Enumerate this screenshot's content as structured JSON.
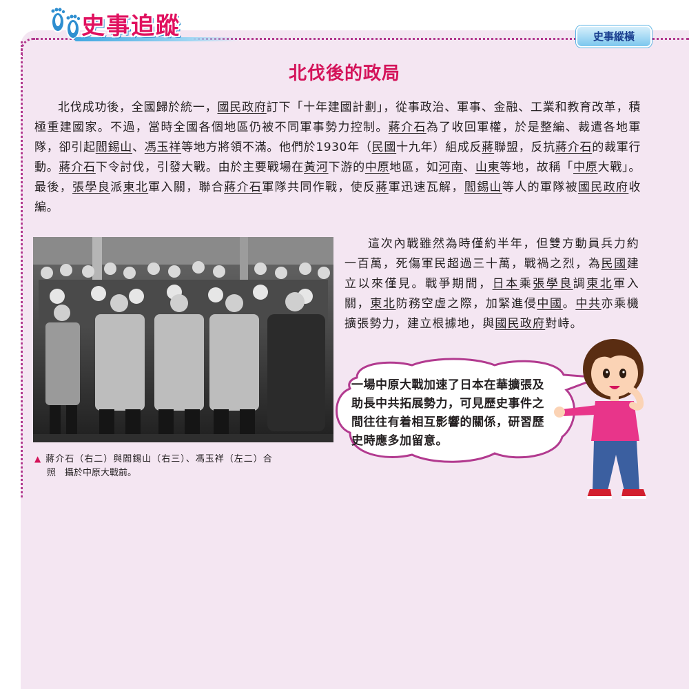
{
  "header": {
    "logo_title": "史事追蹤",
    "section_tab": "史事縱橫"
  },
  "article": {
    "title": "北伐後的政局",
    "para1": [
      {
        "t": "北伐成功後，全國歸於統一，"
      },
      {
        "t": "國民政府",
        "u": true
      },
      {
        "t": "訂下「十年建國計劃」，從事政治、軍事、金融、工業和教育改革，積極重建國家。不過，當時全國各個地區仍被不同軍事勢力控制。"
      },
      {
        "t": "蔣介石",
        "u": true
      },
      {
        "t": "為了收回軍權，於是整編、裁遣各地軍隊，卻引起"
      },
      {
        "t": "閻錫山",
        "u": true
      },
      {
        "t": "、"
      },
      {
        "t": "馮玉祥",
        "u": true
      },
      {
        "t": "等地方將領不滿。他們於1930年（"
      },
      {
        "t": "民國",
        "u": true
      },
      {
        "t": "十九年）組成反"
      },
      {
        "t": "蔣",
        "u": true
      },
      {
        "t": "聯盟，反抗"
      },
      {
        "t": "蔣介石",
        "u": true
      },
      {
        "t": "的裁軍行動。"
      },
      {
        "t": "蔣介石",
        "u": true
      },
      {
        "t": "下令討伐，引發大戰。由於主要戰場在"
      },
      {
        "t": "黃河",
        "u": true
      },
      {
        "t": "下游的"
      },
      {
        "t": "中原",
        "u": true
      },
      {
        "t": "地區，如"
      },
      {
        "t": "河南",
        "u": true
      },
      {
        "t": "、"
      },
      {
        "t": "山東",
        "u": true
      },
      {
        "t": "等地，故稱「"
      },
      {
        "t": "中原",
        "u": true
      },
      {
        "t": "大戰」。最後，"
      },
      {
        "t": "張學良",
        "u": true
      },
      {
        "t": "派"
      },
      {
        "t": "東北",
        "u": true
      },
      {
        "t": "軍入關，聯合"
      },
      {
        "t": "蔣介石",
        "u": true
      },
      {
        "t": "軍隊共同作戰，使反"
      },
      {
        "t": "蔣",
        "u": true
      },
      {
        "t": "軍迅速瓦解，"
      },
      {
        "t": "閻錫山",
        "u": true
      },
      {
        "t": "等人的軍隊被"
      },
      {
        "t": "國民政府",
        "u": true
      },
      {
        "t": "收編。"
      }
    ],
    "para2": [
      {
        "t": "這次內戰雖然為時僅約半年，但雙方動員兵力約一百萬，死傷軍民超過三十萬，戰禍之烈，為"
      },
      {
        "t": "民國",
        "u": true
      },
      {
        "t": "建立以來僅見。戰爭期間，"
      },
      {
        "t": "日本",
        "u": true
      },
      {
        "t": "乘"
      },
      {
        "t": "張學良",
        "u": true
      },
      {
        "t": "調"
      },
      {
        "t": "東北",
        "u": true
      },
      {
        "t": "軍入關，"
      },
      {
        "t": "東北",
        "u": true
      },
      {
        "t": "防務空虛之際，加緊進侵"
      },
      {
        "t": "中國",
        "u": true
      },
      {
        "t": "。"
      },
      {
        "t": "中共",
        "u": true
      },
      {
        "t": "亦乘機擴張勢力，建立根據地，與"
      },
      {
        "t": "國民政府",
        "u": true
      },
      {
        "t": "對峙。"
      }
    ]
  },
  "photo": {
    "caption_marker": "▲",
    "caption_line1": "蔣介石（右二）與閻錫山（右三）、馮玉祥（左二）合",
    "caption_line2": "照　攝於中原大戰前。"
  },
  "bubble": {
    "text": "一場中原大戰加速了日本在華擴張及助長中共拓展勢力，可見歷史事件之間往往有着相互影響的關係，研習歷史時應多加留意。"
  },
  "colors": {
    "panel_bg": "#f4e6f2",
    "dots": "#b23a8f",
    "title": "#d4145a",
    "tab_text": "#1a3f8f",
    "bubble_border": "#b23a8f"
  },
  "icons": {
    "logo": "footprints-icon",
    "character": "girl-illustration"
  }
}
